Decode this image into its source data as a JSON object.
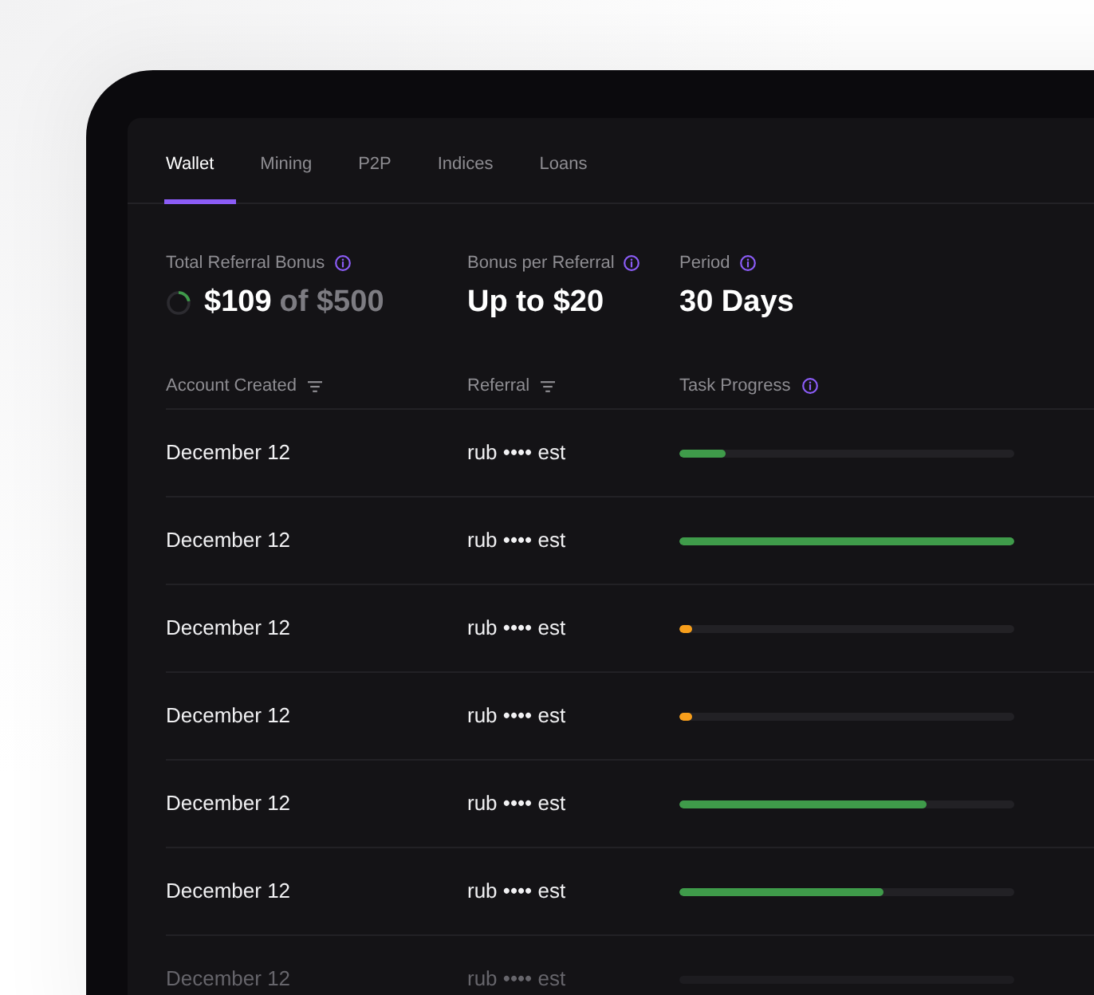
{
  "tabs": [
    {
      "label": "Wallet",
      "selected": true
    },
    {
      "label": "Mining",
      "selected": false
    },
    {
      "label": "P2P",
      "selected": false
    },
    {
      "label": "Indices",
      "selected": false
    },
    {
      "label": "Loans",
      "selected": false
    }
  ],
  "stats": [
    {
      "label": "Total Referral Bonus",
      "kind": "progress",
      "value": "$109",
      "limit": "of $500",
      "level": 0.22
    },
    {
      "label": "Bonus per Referral",
      "kind": "plain",
      "value": "Up to $20"
    },
    {
      "label": "Period",
      "kind": "plain",
      "value": "30 Days"
    }
  ],
  "table": {
    "columns": [
      {
        "label": "Account Created",
        "kind": "filter"
      },
      {
        "label": "Referral",
        "kind": "filter"
      },
      {
        "label": "Task Progress",
        "kind": "info"
      }
    ],
    "rows": [
      {
        "created": "December 12",
        "referral": "rub •••• est",
        "progress": {
          "level": 0.14,
          "color": "#3f9b4a"
        },
        "faded": false
      },
      {
        "created": "December 12",
        "referral": "rub •••• est",
        "progress": {
          "level": 1,
          "color": "#3f9b4a"
        },
        "faded": false
      },
      {
        "created": "December 12",
        "referral": "rub •••• est",
        "progress": {
          "level": 0.04,
          "color": "#f79e1b"
        },
        "faded": false
      },
      {
        "created": "December 12",
        "referral": "rub •••• est",
        "progress": {
          "level": 0.04,
          "color": "#f79e1b"
        },
        "faded": false
      },
      {
        "created": "December 12",
        "referral": "rub •••• est",
        "progress": {
          "level": 0.74,
          "color": "#3f9b4a"
        },
        "faded": false
      },
      {
        "created": "December 12",
        "referral": "rub •••• est",
        "progress": {
          "level": 0.61,
          "color": "#3f9b4a"
        },
        "faded": false
      },
      {
        "created": "December 12",
        "referral": "rub •••• est",
        "faded": true
      }
    ]
  }
}
